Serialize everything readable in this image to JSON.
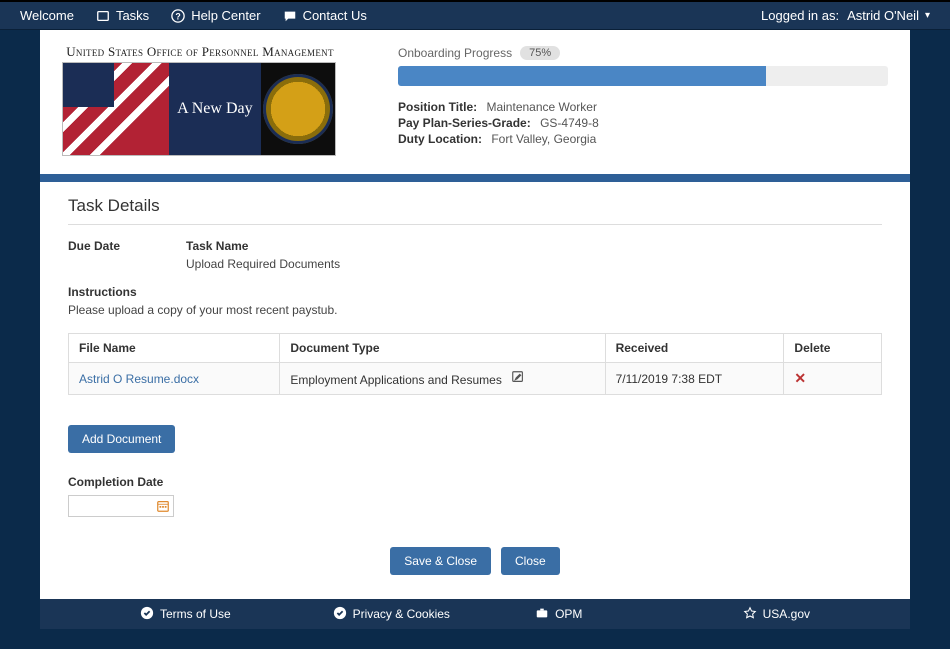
{
  "nav": {
    "welcome": "Welcome",
    "tasks": "Tasks",
    "help": "Help Center",
    "contact": "Contact Us",
    "logged_in_label": "Logged in as:",
    "user_name": "Astrid O'Neil"
  },
  "banner": {
    "org_name": "United States Office of Personnel Management",
    "motto": "A New Day"
  },
  "progress": {
    "label": "Onboarding Progress",
    "pct_text": "75%",
    "pct_value": 75
  },
  "position": {
    "title_label": "Position Title:",
    "title_value": "Maintenance Worker",
    "grade_label": "Pay Plan-Series-Grade:",
    "grade_value": "GS-4749-8",
    "duty_label": "Duty Location:",
    "duty_value": "Fort Valley, Georgia"
  },
  "section": {
    "title": "Task Details",
    "due_date_label": "Due Date",
    "task_name_label": "Task Name",
    "task_name_value": "Upload Required Documents",
    "instructions_label": "Instructions",
    "instructions_text": "Please upload a copy of your most recent paystub."
  },
  "table": {
    "headers": {
      "file": "File Name",
      "type": "Document Type",
      "received": "Received",
      "delete": "Delete"
    },
    "rows": [
      {
        "file": "Astrid O Resume.docx",
        "type": "Employment Applications and Resumes",
        "received": "7/11/2019 7:38 EDT"
      }
    ]
  },
  "buttons": {
    "add_doc": "Add Document",
    "save_close": "Save & Close",
    "close": "Close"
  },
  "completion": {
    "label": "Completion Date",
    "value": ""
  },
  "footer": {
    "terms": "Terms of Use",
    "privacy": "Privacy & Cookies",
    "opm": "OPM",
    "usagov": "USA.gov"
  }
}
